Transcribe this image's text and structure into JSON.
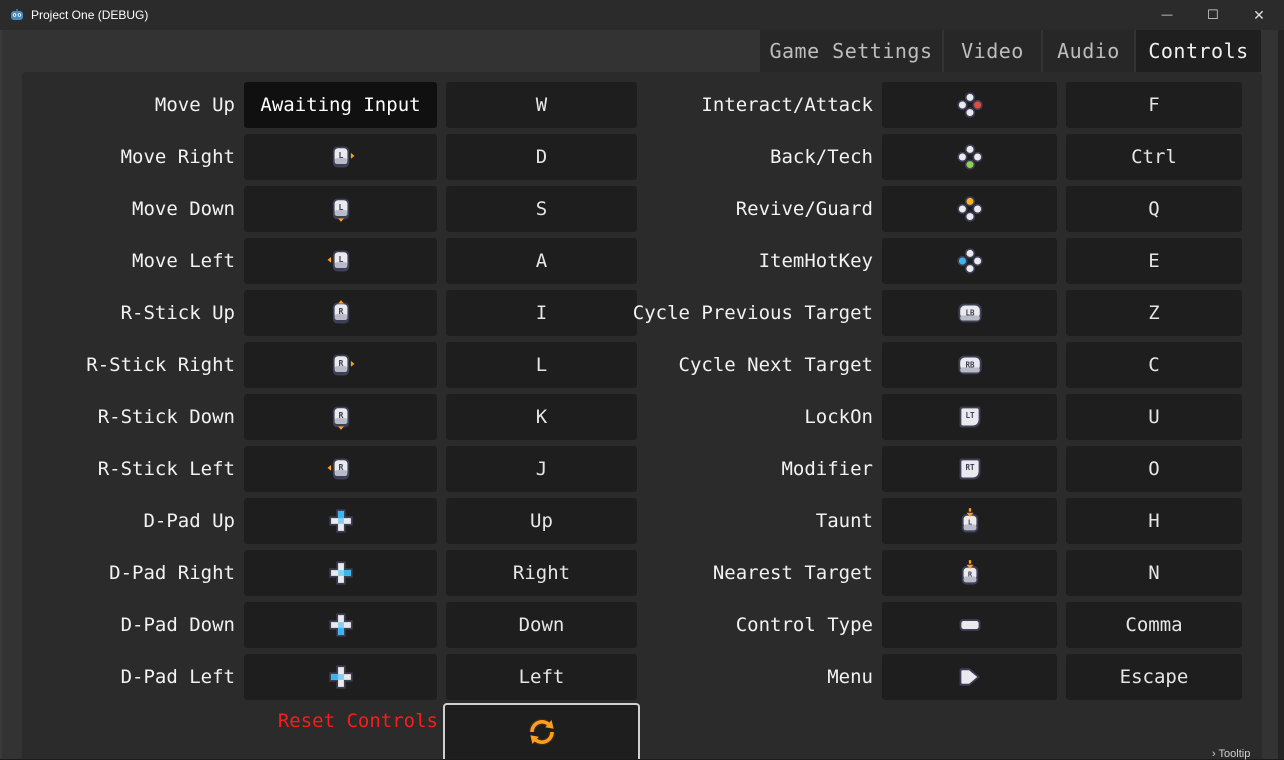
{
  "window": {
    "title": "Project One (DEBUG)",
    "minimize_glyph": "—",
    "maximize_glyph": "☐",
    "close_glyph": "✕"
  },
  "tabs": [
    {
      "label": "Game Settings",
      "active": false
    },
    {
      "label": "Video",
      "active": false
    },
    {
      "label": "Audio",
      "active": false
    },
    {
      "label": "Controls",
      "active": true
    }
  ],
  "left_bindings": [
    {
      "action": "Move Up",
      "pad_text": "Awaiting Input",
      "pad_icon": "",
      "key": "W"
    },
    {
      "action": "Move Right",
      "pad_text": "",
      "pad_icon": "left-stick-right-icon",
      "key": "D"
    },
    {
      "action": "Move Down",
      "pad_text": "",
      "pad_icon": "left-stick-down-icon",
      "key": "S"
    },
    {
      "action": "Move Left",
      "pad_text": "",
      "pad_icon": "left-stick-left-icon",
      "key": "A"
    },
    {
      "action": "R-Stick Up",
      "pad_text": "",
      "pad_icon": "right-stick-up-icon",
      "key": "I"
    },
    {
      "action": "R-Stick Right",
      "pad_text": "",
      "pad_icon": "right-stick-right-icon",
      "key": "L"
    },
    {
      "action": "R-Stick Down",
      "pad_text": "",
      "pad_icon": "right-stick-down-icon",
      "key": "K"
    },
    {
      "action": "R-Stick Left",
      "pad_text": "",
      "pad_icon": "right-stick-left-icon",
      "key": "J"
    },
    {
      "action": "D-Pad Up",
      "pad_text": "",
      "pad_icon": "dpad-up-icon",
      "key": "Up"
    },
    {
      "action": "D-Pad Right",
      "pad_text": "",
      "pad_icon": "dpad-right-icon",
      "key": "Right"
    },
    {
      "action": "D-Pad Down",
      "pad_text": "",
      "pad_icon": "dpad-down-icon",
      "key": "Down"
    },
    {
      "action": "D-Pad Left",
      "pad_text": "",
      "pad_icon": "dpad-left-icon",
      "key": "Left"
    }
  ],
  "right_bindings": [
    {
      "action": "Interact/Attack",
      "pad_icon": "face-button-right-icon",
      "key": "F"
    },
    {
      "action": "Back/Tech",
      "pad_icon": "face-button-bottom-icon",
      "key": "Ctrl"
    },
    {
      "action": "Revive/Guard",
      "pad_icon": "face-button-top-icon",
      "key": "Q"
    },
    {
      "action": "ItemHotKey",
      "pad_icon": "face-button-left-icon",
      "key": "E"
    },
    {
      "action": "Cycle Previous Target",
      "pad_icon": "lb-button-icon",
      "key": "Z"
    },
    {
      "action": "Cycle Next Target",
      "pad_icon": "rb-button-icon",
      "key": "C"
    },
    {
      "action": "LockOn",
      "pad_icon": "lt-trigger-icon",
      "key": "U"
    },
    {
      "action": "Modifier",
      "pad_icon": "rt-trigger-icon",
      "key": "O"
    },
    {
      "action": "Taunt",
      "pad_icon": "left-stick-press-icon",
      "key": "H"
    },
    {
      "action": "Nearest Target",
      "pad_icon": "right-stick-press-icon",
      "key": "N"
    },
    {
      "action": "Control Type",
      "pad_icon": "select-button-icon",
      "key": "Comma"
    },
    {
      "action": "Menu",
      "pad_icon": "start-button-icon",
      "key": "Escape"
    }
  ],
  "stick_letters": {
    "left": "L",
    "right": "R"
  },
  "shoulder_labels": {
    "lb": "LB",
    "rb": "RB",
    "lt": "LT",
    "rt": "RT"
  },
  "reset": {
    "label": "Reset Controls",
    "icon": "reset-arrows-icon"
  },
  "tooltip_hint": "› Tooltip",
  "colors": {
    "accent_orange": "#ff9d1e",
    "dpad_blue": "#38b6f0",
    "face_red": "#e8493c",
    "face_green": "#8fd14f",
    "face_yellow": "#ffb020",
    "face_blue": "#38b6f0",
    "reset_red": "#ff1a1a"
  }
}
